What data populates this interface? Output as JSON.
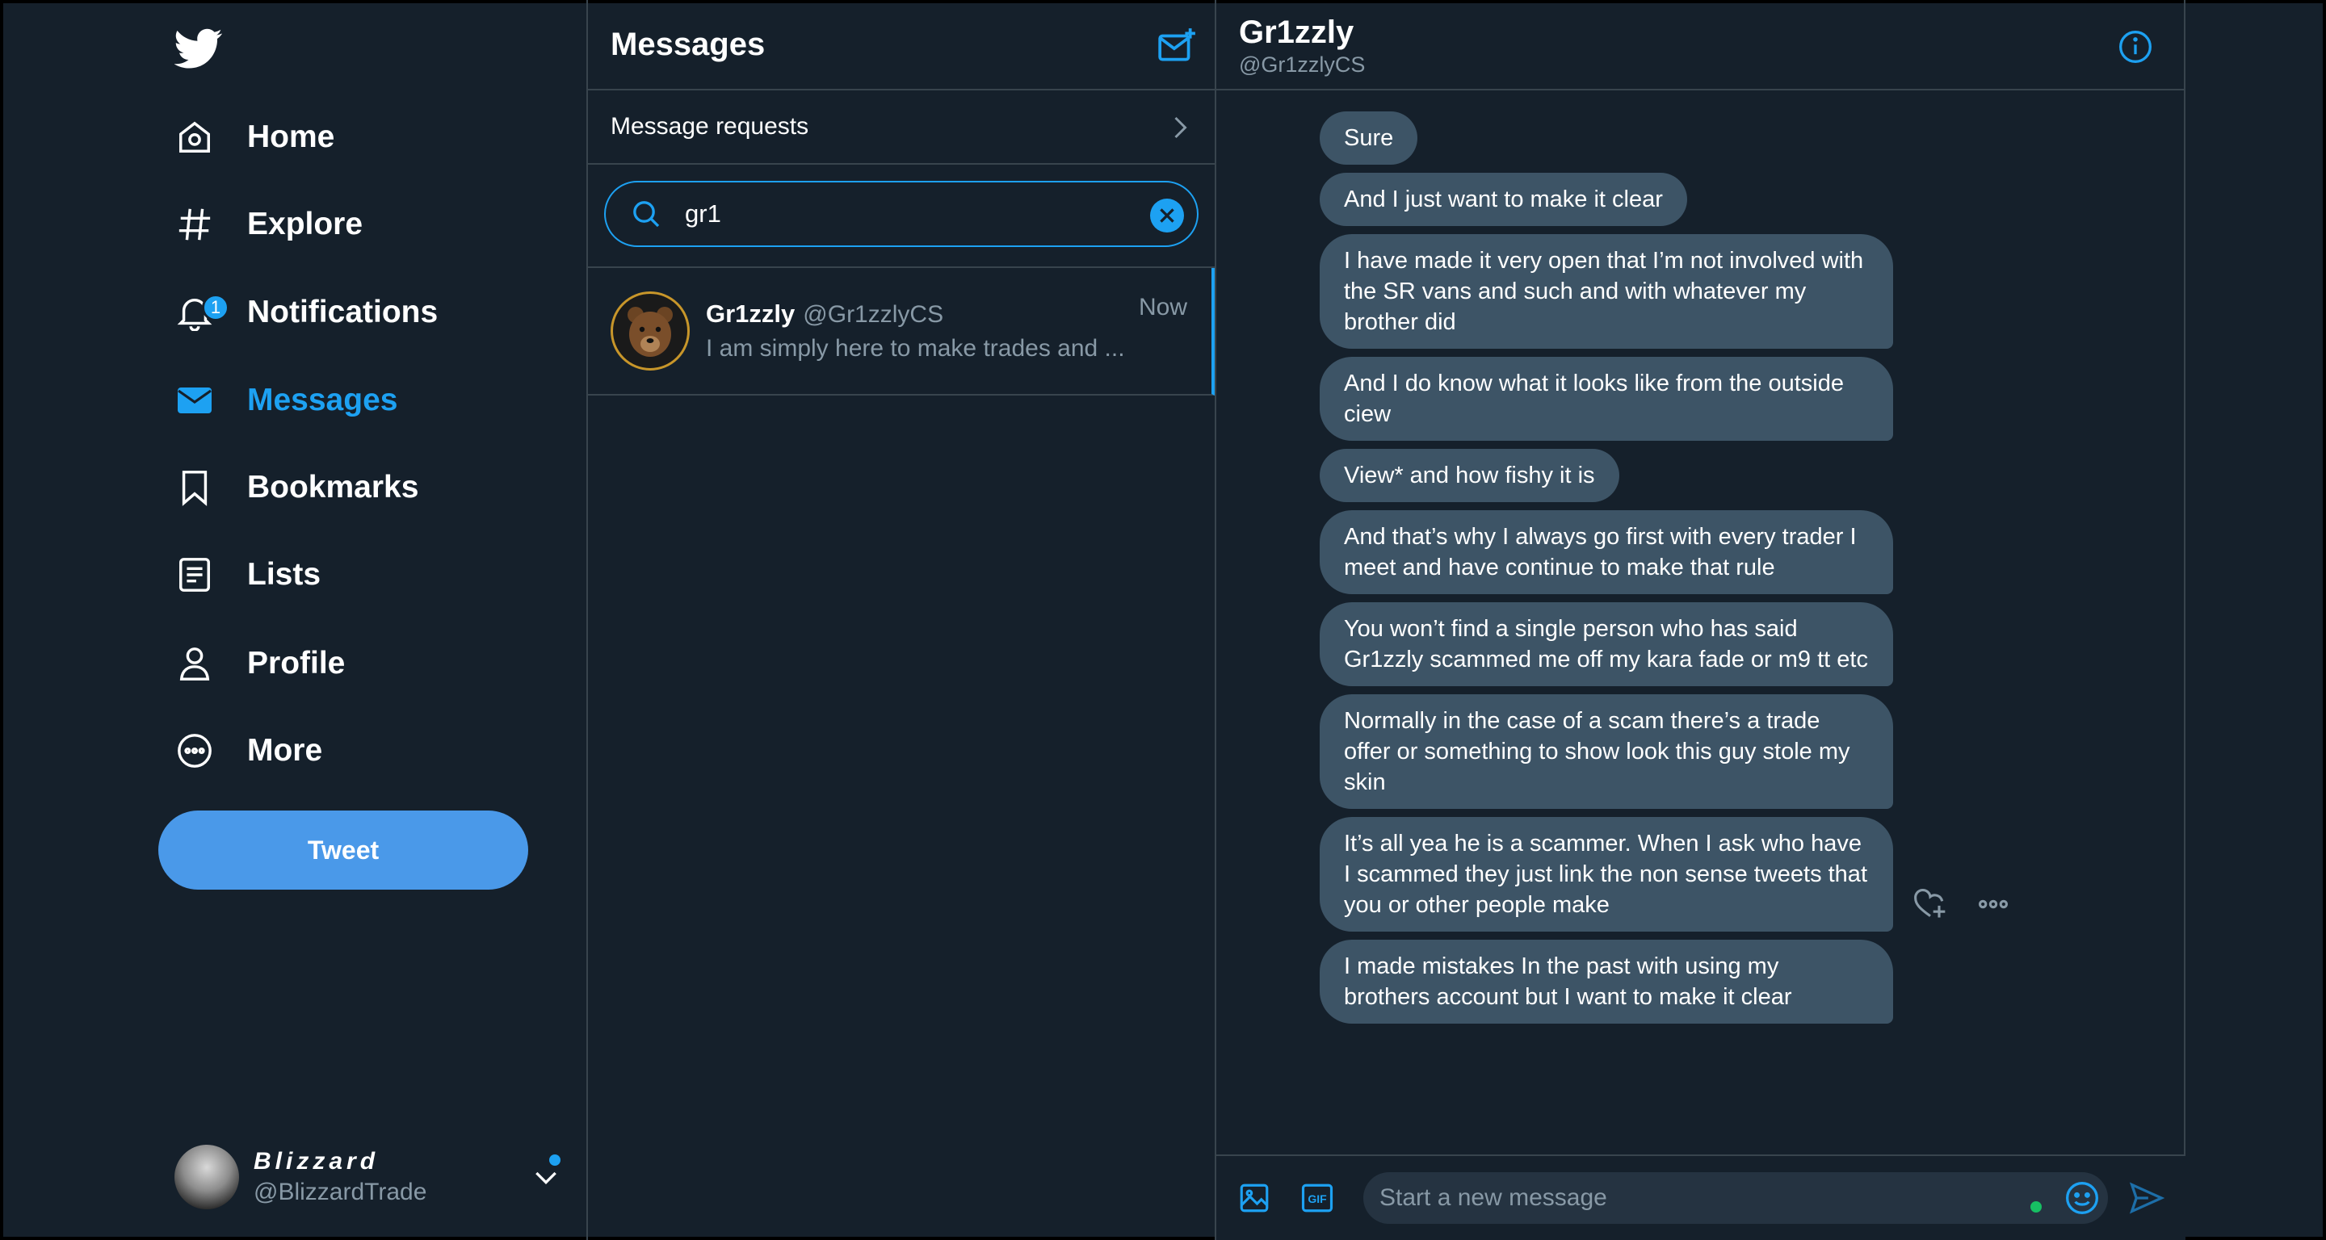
{
  "sidebar": {
    "items": [
      {
        "label": "Home"
      },
      {
        "label": "Explore"
      },
      {
        "label": "Notifications",
        "badge": "1"
      },
      {
        "label": "Messages"
      },
      {
        "label": "Bookmarks"
      },
      {
        "label": "Lists"
      },
      {
        "label": "Profile"
      },
      {
        "label": "More"
      }
    ],
    "tweet_label": "Tweet",
    "account": {
      "name": "Blizzard",
      "handle": "@BlizzardTrade"
    }
  },
  "messages": {
    "title": "Messages",
    "requests_label": "Message requests",
    "search": {
      "value": "gr1"
    },
    "conversations": [
      {
        "name": "Gr1zzly",
        "handle": "@Gr1zzlyCS",
        "time": "Now",
        "preview": "I am simply here to make trades and ..."
      }
    ]
  },
  "chat": {
    "name": "Gr1zzly",
    "handle": "@Gr1zzlyCS",
    "messages": [
      "Sure",
      "And I just want to make it clear",
      "I have made it very open that I’m not involved with the SR vans and such and with whatever my brother did",
      "And I do know what it looks like from the outside ciew",
      "View* and how fishy it is",
      "And that’s why I always go first with every trader I meet and have continue to make that rule",
      "You won’t find a single person who has said Gr1zzly scammed me off my kara fade or m9 tt etc",
      "Normally in the case of a scam there’s a trade offer or something to show look this guy stole my skin",
      "It’s all yea he is a scammer. When I ask who have I scammed they just link the non sense tweets that you or other people make",
      "I made mistakes In the past with using my brothers account but I want to make it clear"
    ],
    "composer_placeholder": "Start a new message",
    "gif_label": "GIF"
  },
  "colors": {
    "accent": "#1da1f2",
    "background": "#15202b",
    "bubble": "#3d5466",
    "border": "#38444d",
    "muted": "#8899a6"
  },
  "icons": [
    "twitter-bird-icon",
    "home-icon",
    "hashtag-icon",
    "bell-icon",
    "envelope-icon",
    "bookmark-icon",
    "list-icon",
    "person-icon",
    "more-circle-icon",
    "chevron-down-icon",
    "compose-message-icon",
    "chevron-right-icon",
    "search-icon",
    "clear-icon",
    "info-icon",
    "heart-plus-icon",
    "more-dots-icon",
    "image-icon",
    "gif-icon",
    "emoji-icon",
    "send-icon"
  ]
}
